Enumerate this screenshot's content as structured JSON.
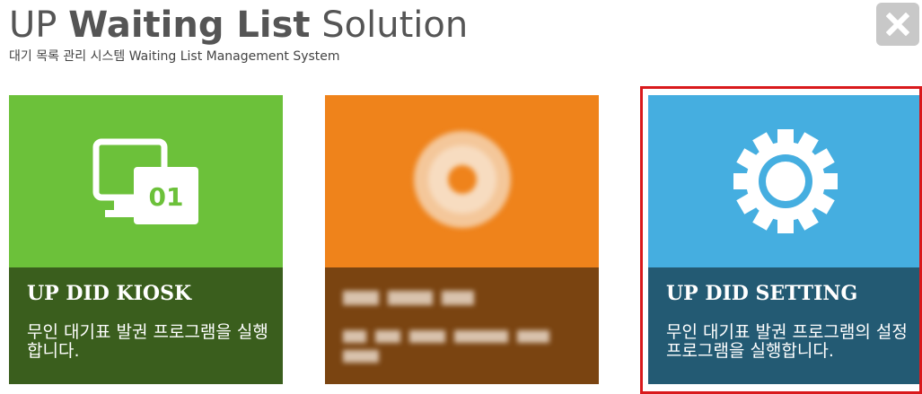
{
  "header": {
    "title_prefix": "UP",
    "title_bold": "Waiting List",
    "title_suffix": "Solution",
    "subtitle": "대기 목록 관리 시스템 Waiting List Management System"
  },
  "close_button": {
    "icon": "close-icon"
  },
  "tiles": [
    {
      "title": "UP DID KIOSK",
      "description": "무인 대기표 발권 프로그램을 실행합니다.",
      "icon": "monitor-01-icon",
      "icon_text": "01",
      "top_color": "#6cc13a",
      "bottom_color": "#3a5e1d"
    },
    {
      "title": "",
      "description": "",
      "icon": "blurred-icon",
      "top_color": "#ef831b",
      "bottom_color": "#7a4411"
    },
    {
      "title": "UP DID SETTING",
      "description": "무인 대기표 발권 프로그램의 설정 프로그램을 실행합니다.",
      "icon": "gear-icon",
      "top_color": "#45aee0",
      "bottom_color": "#235a73",
      "selected": true
    }
  ],
  "colors": {
    "selection": "#d9191c"
  }
}
